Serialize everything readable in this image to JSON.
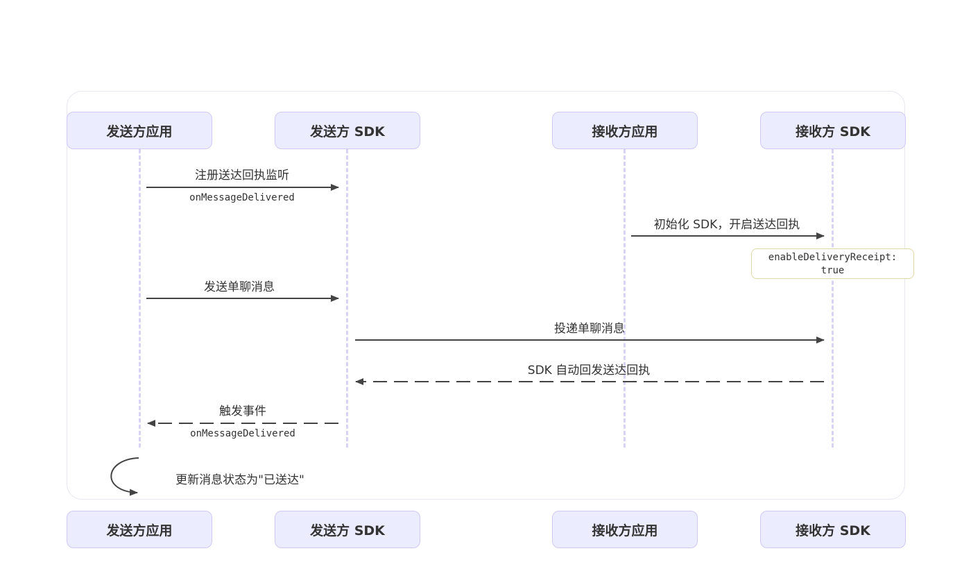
{
  "actors": [
    {
      "name": "发送方应用"
    },
    {
      "name": "发送方 SDK"
    },
    {
      "name": "接收方应用"
    },
    {
      "name": "接收方 SDK"
    }
  ],
  "messages": [
    {
      "label": "注册送达回执监听",
      "sub": "onMessageDelivered",
      "from": "发送方应用",
      "to": "发送方 SDK",
      "style": "solid"
    },
    {
      "label": "初始化 SDK，开启送达回执",
      "from": "接收方应用",
      "to": "接收方 SDK",
      "style": "solid"
    },
    {
      "label": "发送单聊消息",
      "from": "发送方应用",
      "to": "发送方 SDK",
      "style": "solid"
    },
    {
      "label": "投递单聊消息",
      "from": "发送方 SDK",
      "to": "接收方 SDK",
      "style": "solid"
    },
    {
      "label": "SDK 自动回发送达回执",
      "from": "接收方 SDK",
      "to": "发送方 SDK",
      "style": "dashed"
    },
    {
      "label": "触发事件",
      "sub": "onMessageDelivered",
      "from": "发送方 SDK",
      "to": "发送方应用",
      "style": "dashed"
    },
    {
      "label": "更新消息状态为\"已送达\"",
      "from": "发送方应用",
      "to": "发送方应用",
      "style": "self"
    }
  ],
  "note": {
    "line1": "enableDeliveryReceipt:",
    "line2": "true"
  },
  "colors": {
    "actor_fill": "#ECECFF",
    "actor_border": "#cfc8f2",
    "lifeline": "#d9d2f5",
    "arrow": "#444444",
    "note_border": "#e0d7a8"
  }
}
